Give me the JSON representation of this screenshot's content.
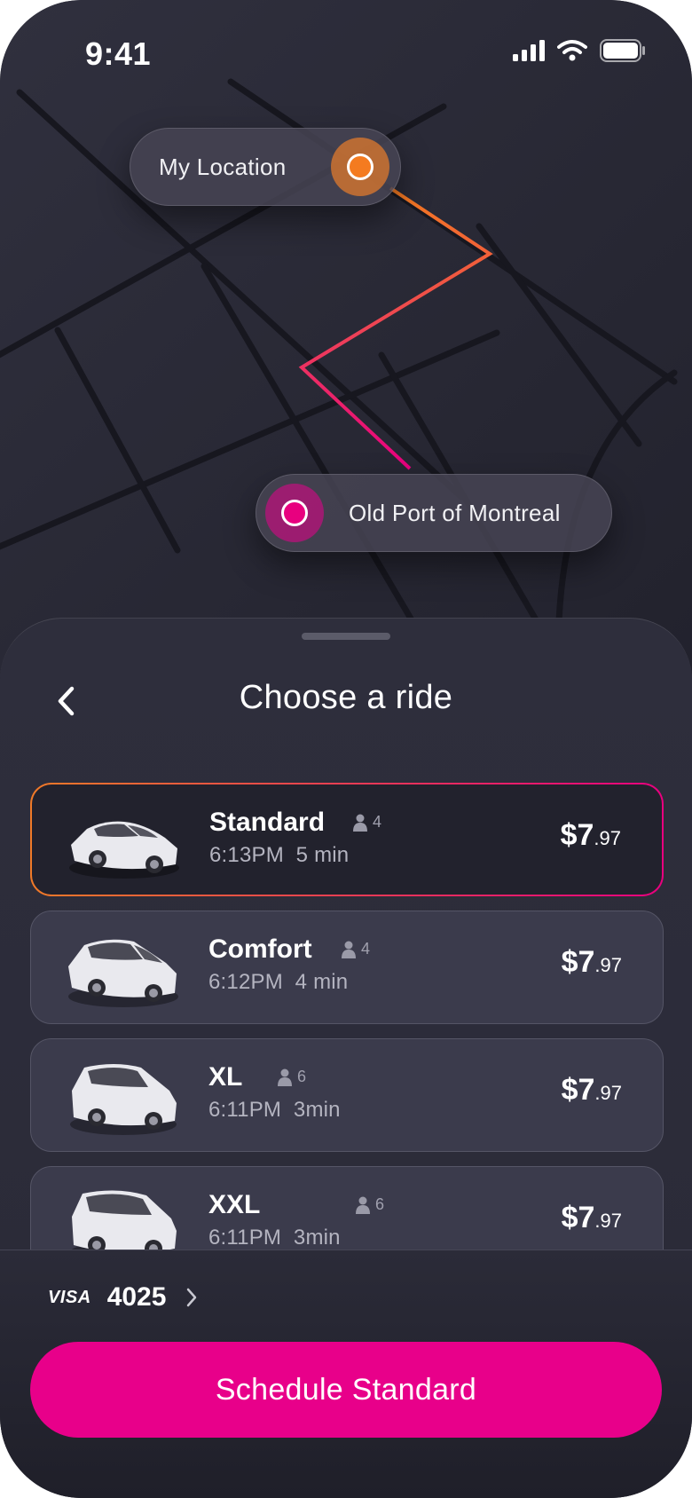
{
  "status_bar": {
    "time": "9:41",
    "icons": [
      "signal-icon",
      "wifi-icon",
      "battery-icon"
    ]
  },
  "map": {
    "origin_label": "My Location",
    "destination_label": "Old Port of Montreal",
    "route_colors": [
      "#f47b20",
      "#e8007f"
    ]
  },
  "sheet": {
    "title": "Choose a ride",
    "back_icon": "chevron-left-icon"
  },
  "rides": [
    {
      "name": "Standard",
      "capacity": "4",
      "time": "6:13PM",
      "eta": "5 min",
      "price_main": "$7",
      "price_cents": ".97",
      "selected": true
    },
    {
      "name": "Comfort",
      "capacity": "4",
      "time": "6:12PM",
      "eta": "4 min",
      "price_main": "$7",
      "price_cents": ".97",
      "selected": false
    },
    {
      "name": "XL",
      "capacity": "6",
      "time": "6:11PM",
      "eta": "3min",
      "price_main": "$7",
      "price_cents": ".97",
      "selected": false
    },
    {
      "name": "XXL",
      "capacity": "6",
      "time": "6:11PM",
      "eta": "3min",
      "price_main": "$7",
      "price_cents": ".97",
      "selected": false
    }
  ],
  "payment": {
    "brand": "VISA",
    "last4": "4025"
  },
  "cta": {
    "label": "Schedule Standard"
  },
  "colors": {
    "accent": "#e8008a",
    "origin": "#f47b20",
    "background": "#23232f"
  }
}
